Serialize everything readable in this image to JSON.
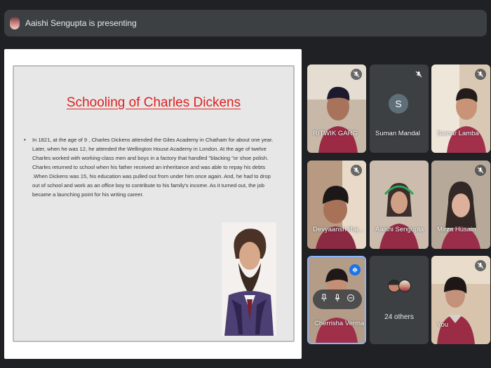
{
  "header": {
    "presenter_text": "Aaishi Sengupta is presenting"
  },
  "slide": {
    "title": "Schooling of Charles Dickens",
    "bullet": "•",
    "body": "In 1821, at the age of 9 , Charles Dickens attended the Giles Academy in Chatham for about one year. Later, when he was 12, he attended the Wellington House Academy in London. At the age of twelve Charles worked with working-class men and boys in a factory that handled \"blacking \"or shoe polish. Charles returned to school when his father received an inheritance and was able to repay his debts .When Dickens was 15, his education was pulled out from under him once again. And, he had to drop out of school and work as an office boy to contribute to his family's income. As it turned out, the job became a launching point for his writing career."
  },
  "participants": [
    {
      "name": "RITWIK GARG",
      "muted": true
    },
    {
      "name": "Suman Mandal",
      "muted": true,
      "avatar_letter": "S",
      "camera_off": true
    },
    {
      "name": "Samar Lamba",
      "muted": true
    },
    {
      "name": "Devyaansh Raj...",
      "muted": true
    },
    {
      "name": "Aaishi Sengupta",
      "muted": false
    },
    {
      "name": "Mirza Husain",
      "muted": true
    },
    {
      "name": "Cherrisha Verma",
      "muted": false,
      "speaking": true
    },
    {
      "name": "You",
      "muted": true
    }
  ],
  "others": {
    "label": "24 others"
  },
  "icons": {
    "mic_off": "mic-off-icon",
    "pin": "pin-icon",
    "mic": "mic-icon",
    "remove": "remove-icon",
    "speaking": "audio-level-icon"
  },
  "colors": {
    "accent": "#8ab4f8",
    "speaking": "#1a73e8",
    "title_red": "#e02020",
    "bg": "#202124",
    "tile": "#3c4043"
  }
}
